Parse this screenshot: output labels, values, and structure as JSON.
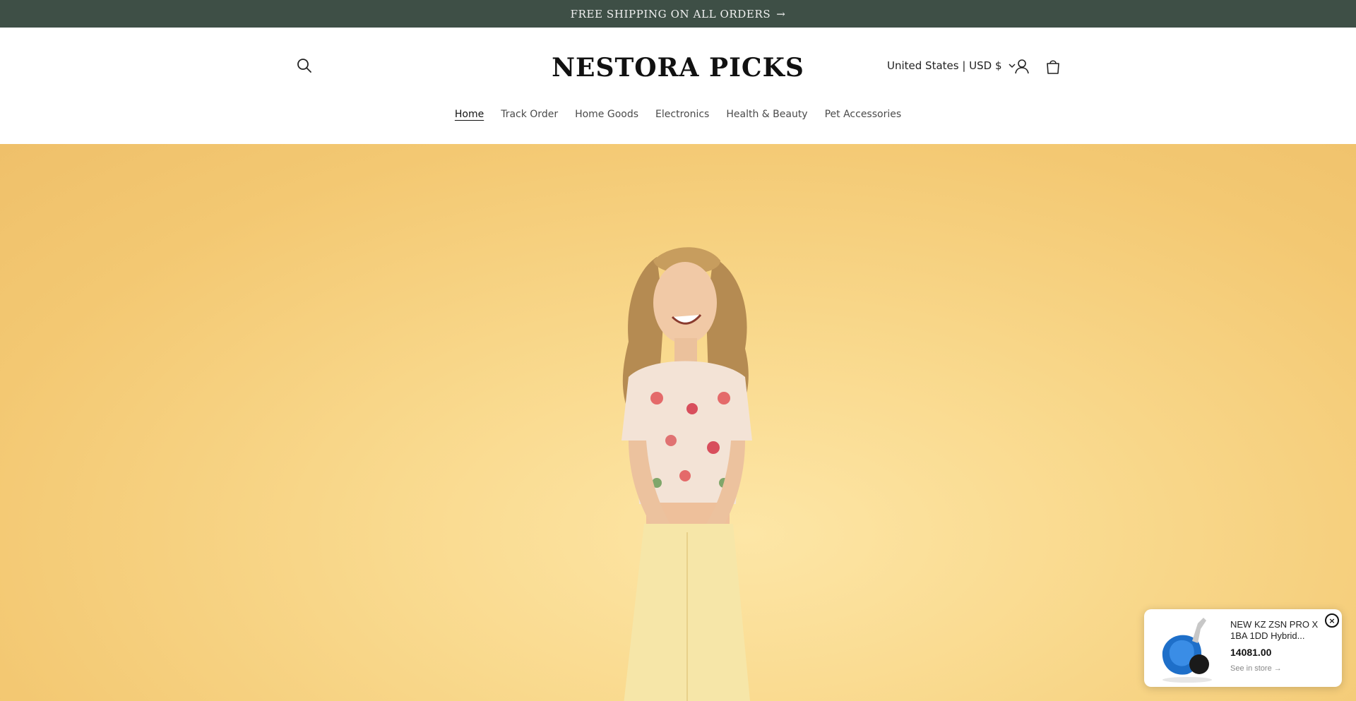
{
  "announcement": {
    "text": "FREE SHIPPING ON ALL ORDERS",
    "arrow": "→",
    "bg_color": "#3e4f46"
  },
  "header": {
    "logo": "NESTORA PICKS",
    "country_selector": "United States | USD $",
    "icons": [
      "search-icon",
      "account-icon",
      "cart-icon",
      "chevron-down-icon"
    ]
  },
  "nav": {
    "items": [
      {
        "label": "Home",
        "active": true
      },
      {
        "label": "Track Order"
      },
      {
        "label": "Home Goods"
      },
      {
        "label": "Electronics"
      },
      {
        "label": "Health & Beauty"
      },
      {
        "label": "Pet Accessories"
      }
    ]
  },
  "hero": {
    "bg_color": "#f9d98d"
  },
  "popup": {
    "title": "NEW KZ ZSN PRO X 1BA 1DD Hybrid...",
    "price": "14081.00",
    "link": "See in store →",
    "close": "×"
  }
}
